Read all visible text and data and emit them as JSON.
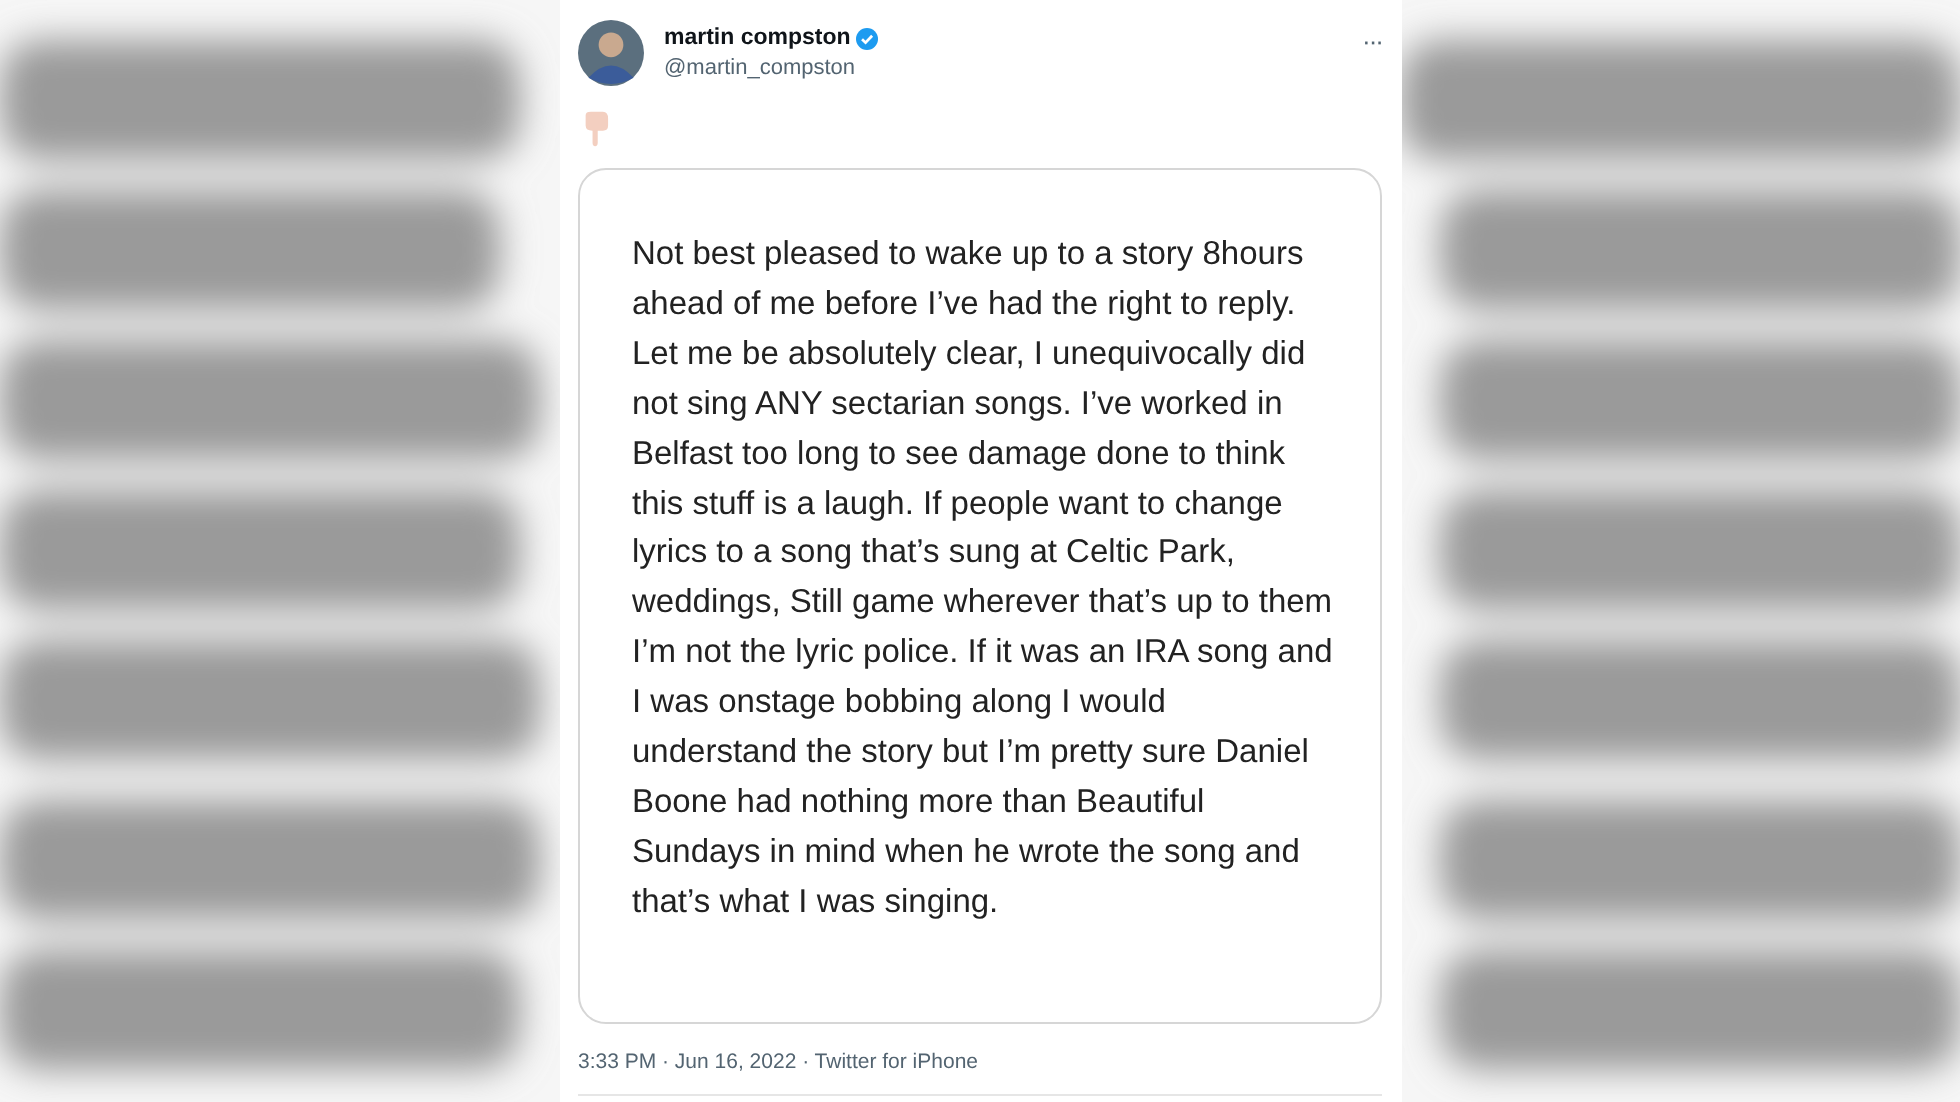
{
  "tweet": {
    "author_name": "martin compston",
    "verified": true,
    "handle": "@martin_compston",
    "more": "···",
    "note": "Not best pleased to wake up to a story 8hours ahead of me before I’ve had the right to reply. Let me be absolutely clear, I unequivocally did not sing ANY sectarian songs. I’ve worked in Belfast too long to see damage done to think this stuff is a laugh. If people want to change lyrics to a song that’s sung at Celtic Park, weddings, Still game wherever that’s up to them I’m not the lyric police. If it was an IRA song and I was onstage bobbing along I would understand the story but I’m pretty sure Daniel Boone had nothing more than Beautiful Sundays in mind when he wrote the song and that’s what I was singing.",
    "footer": "3:33 PM · Jun 16, 2022 · Twitter for iPhone"
  }
}
